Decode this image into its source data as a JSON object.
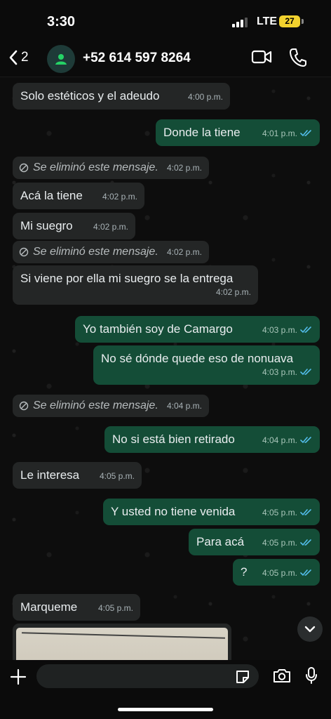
{
  "status_bar": {
    "time": "3:30",
    "network": "LTE",
    "battery": "27"
  },
  "header": {
    "back_count": "2",
    "contact_name": "+52 614 597 8264"
  },
  "messages": [
    {
      "direction": "in",
      "text": "Solo estéticos y el adeudo",
      "time": "4:00 p.m."
    },
    {
      "direction": "out",
      "text": "Donde la tiene",
      "time": "4:01 p.m.",
      "read": true
    },
    {
      "direction": "in",
      "deleted": true,
      "text": "Se eliminó este mensaje.",
      "time": "4:02 p.m."
    },
    {
      "direction": "in",
      "text": "Acá la tiene",
      "time": "4:02 p.m."
    },
    {
      "direction": "in",
      "text": "Mi suegro",
      "time": "4:02 p.m."
    },
    {
      "direction": "in",
      "deleted": true,
      "text": "Se eliminó este mensaje.",
      "time": "4:02 p.m."
    },
    {
      "direction": "in",
      "text": "Si viene por ella mi suegro se la entrega",
      "time": "4:02 p.m."
    },
    {
      "direction": "out",
      "text": "Yo también soy de Camargo",
      "time": "4:03 p.m.",
      "read": true
    },
    {
      "direction": "out",
      "text": "No sé dónde quede eso de nonuava",
      "time": "4:03 p.m.",
      "read": true
    },
    {
      "direction": "in",
      "deleted": true,
      "text": "Se eliminó este mensaje.",
      "time": "4:04 p.m."
    },
    {
      "direction": "out",
      "text": "No si está bien retirado",
      "time": "4:04 p.m.",
      "read": true
    },
    {
      "direction": "in",
      "text": "Le interesa",
      "time": "4:05 p.m."
    },
    {
      "direction": "out",
      "text": "Y usted no tiene venida",
      "time": "4:05 p.m.",
      "read": true
    },
    {
      "direction": "out",
      "text": "Para acá",
      "time": "4:05 p.m.",
      "read": true
    },
    {
      "direction": "out",
      "text": "?",
      "time": "4:05 p.m.",
      "read": true
    },
    {
      "direction": "in",
      "text": "Marqueme",
      "time": "4:05 p.m."
    }
  ],
  "colors": {
    "incoming_bubble": "#242626",
    "outgoing_bubble": "#144d37",
    "read_ticks": "#53bdeb",
    "avatar_accent": "#25d366"
  },
  "icons": [
    "back-chevron-icon",
    "person-icon",
    "video-call-icon",
    "phone-icon",
    "plus-icon",
    "sticker-icon",
    "camera-icon",
    "microphone-icon",
    "chevron-down-icon",
    "deleted-icon",
    "double-check-icon"
  ]
}
